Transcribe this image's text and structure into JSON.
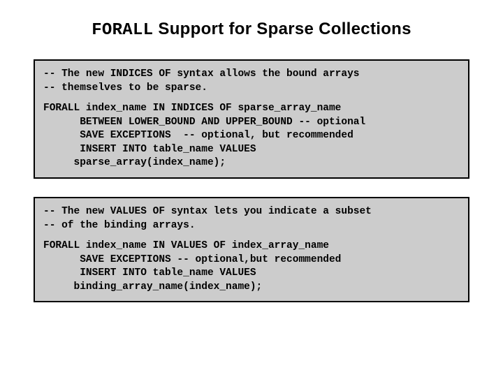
{
  "title": {
    "code_word": "FORALL",
    "rest": " Support for Sparse Collections"
  },
  "boxes": [
    {
      "comment": "-- The new INDICES OF syntax allows the bound arrays\n-- themselves to be sparse.",
      "code": "FORALL index_name IN INDICES OF sparse_array_name\n      BETWEEN LOWER_BOUND AND UPPER_BOUND -- optional\n      SAVE EXCEPTIONS  -- optional, but recommended\n      INSERT INTO table_name VALUES\n     sparse_array(index_name);"
    },
    {
      "comment": "-- The new VALUES OF syntax lets you indicate a subset\n-- of the binding arrays.",
      "code": "FORALL index_name IN VALUES OF index_array_name\n      SAVE EXCEPTIONS -- optional,but recommended\n      INSERT INTO table_name VALUES\n     binding_array_name(index_name);"
    }
  ]
}
